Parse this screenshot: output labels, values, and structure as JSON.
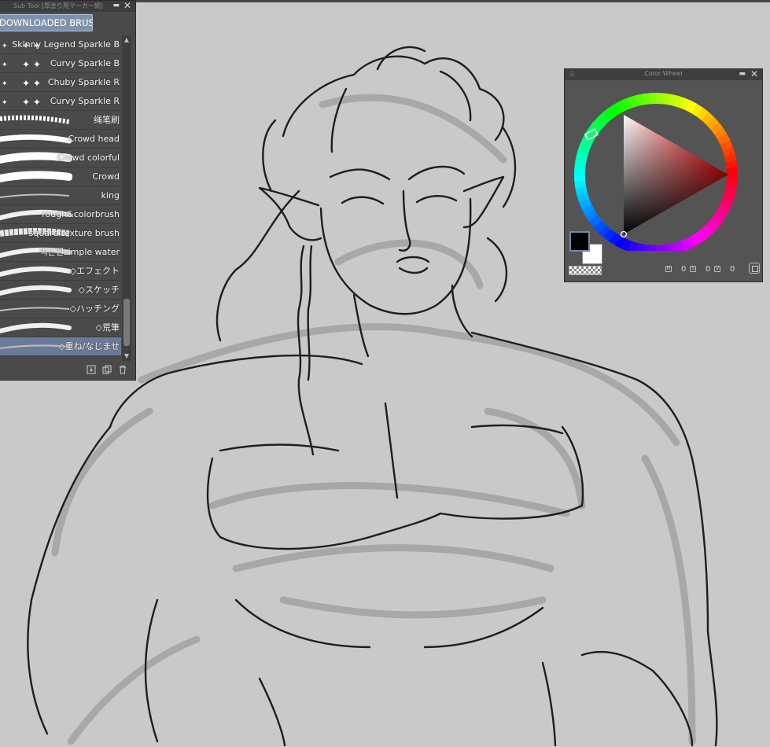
{
  "sub_tool_panel": {
    "title": "Sub Tool [厚塗り用マーカー網]",
    "group_tab": "DOWNLOADED BRUSH",
    "brushes": [
      {
        "label": "Skinny Legend Sparkle B",
        "selected": false
      },
      {
        "label": "Curvy Sparkle B",
        "selected": false
      },
      {
        "label": "Chuby Sparkle R",
        "selected": false
      },
      {
        "label": "Curvy Sparkle R",
        "selected": false
      },
      {
        "label": "绳笔刷",
        "selected": false
      },
      {
        "label": "Crowd head",
        "selected": false
      },
      {
        "label": "Crowd colorful",
        "selected": false
      },
      {
        "label": "Crowd",
        "selected": false
      },
      {
        "label": "king",
        "selected": false
      },
      {
        "label": "rough&colorbrush",
        "selected": false
      },
      {
        "label": "square texture brush",
        "selected": false
      },
      {
        "label": "먹는펜simple water",
        "selected": false
      },
      {
        "label": "◇エフェクト",
        "selected": false
      },
      {
        "label": "◇スケッチ",
        "selected": false
      },
      {
        "label": "◇ハッチング",
        "selected": false
      },
      {
        "label": "◇荒筆",
        "selected": false
      },
      {
        "label": "◇重ね/なじませ",
        "selected": true
      }
    ],
    "footer_icons": [
      "import-icon",
      "duplicate-icon",
      "trash-icon"
    ]
  },
  "color_wheel_panel": {
    "title": "Color Wheel",
    "main_color": "#000000",
    "sub_color": "#ffffff",
    "hue_marker_color": "#ff0066",
    "values": [
      "0",
      "0",
      "0"
    ]
  },
  "canvas": {
    "background": "#c9c9c9",
    "line_color": "#1e1e1e",
    "sketch_color": "#8d8d8d"
  }
}
